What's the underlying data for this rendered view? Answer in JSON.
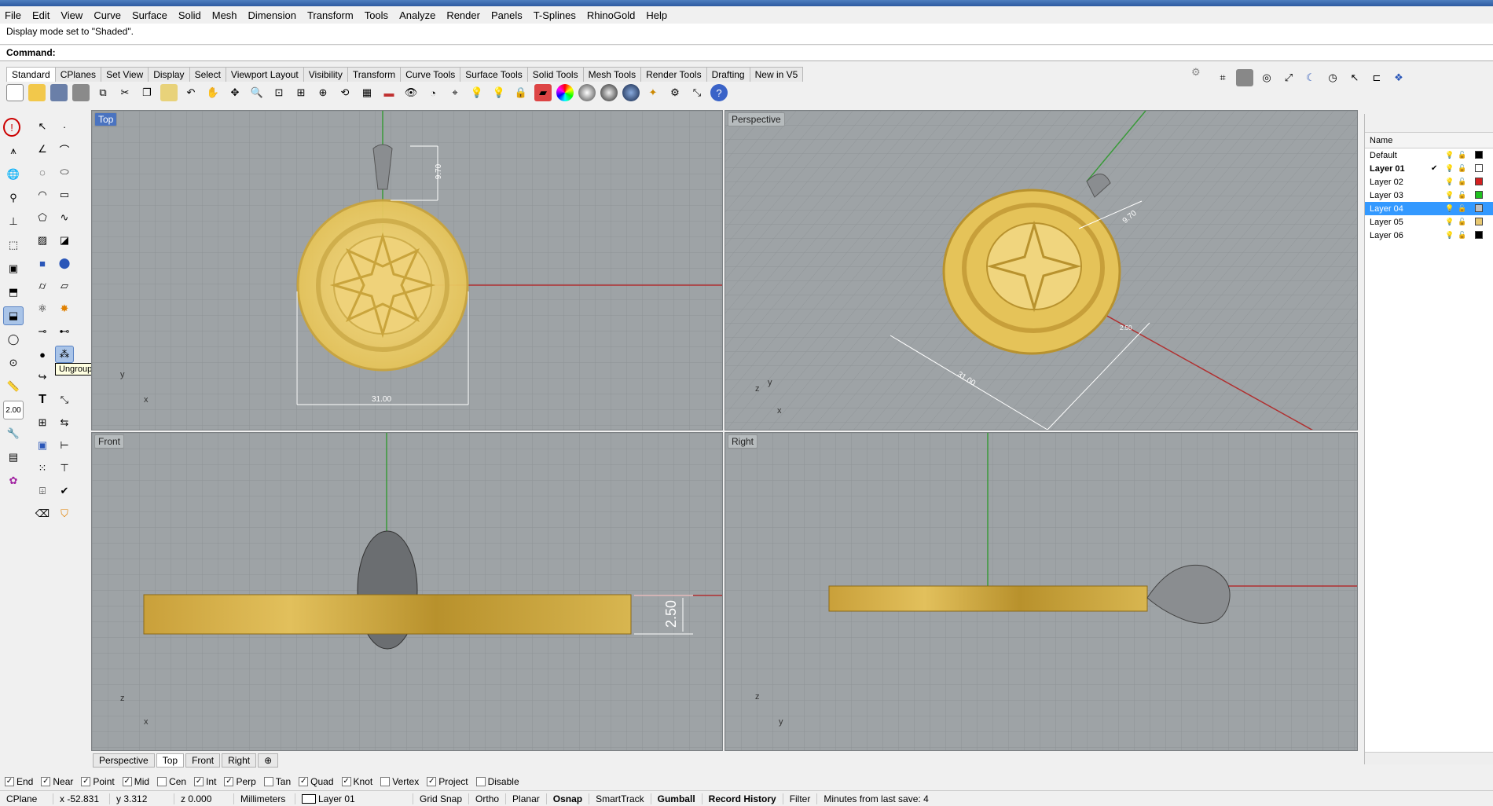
{
  "menu": [
    "File",
    "Edit",
    "View",
    "Curve",
    "Surface",
    "Solid",
    "Mesh",
    "Dimension",
    "Transform",
    "Tools",
    "Analyze",
    "Render",
    "Panels",
    "T-Splines",
    "RhinoGold",
    "Help"
  ],
  "command": {
    "history": "Display mode set to \"Shaded\".",
    "prompt": "Command:"
  },
  "toolbar_tabs": [
    "Standard",
    "CPlanes",
    "Set View",
    "Display",
    "Select",
    "Viewport Layout",
    "Visibility",
    "Transform",
    "Curve Tools",
    "Surface Tools",
    "Solid Tools",
    "Mesh Tools",
    "Render Tools",
    "Drafting",
    "New in V5"
  ],
  "tooltip": "Ungroup",
  "left_value": "2.00",
  "viewports": {
    "top": "Top",
    "perspective": "Perspective",
    "front": "Front",
    "right": "Right"
  },
  "dimensions": {
    "top_height": "9.70",
    "top_width": "31.00",
    "persp_height": "9.70",
    "persp_width": "31.00",
    "persp_small": "2.50",
    "front_thickness": "2.50"
  },
  "axes": {
    "x": "x",
    "y": "y",
    "z": "z"
  },
  "viewport_tabs": [
    "Perspective",
    "Top",
    "Front",
    "Right"
  ],
  "osnaps": [
    {
      "label": "End",
      "on": true
    },
    {
      "label": "Near",
      "on": true
    },
    {
      "label": "Point",
      "on": true
    },
    {
      "label": "Mid",
      "on": true
    },
    {
      "label": "Cen",
      "on": false
    },
    {
      "label": "Int",
      "on": true
    },
    {
      "label": "Perp",
      "on": true
    },
    {
      "label": "Tan",
      "on": false
    },
    {
      "label": "Quad",
      "on": true
    },
    {
      "label": "Knot",
      "on": true
    },
    {
      "label": "Vertex",
      "on": false
    },
    {
      "label": "Project",
      "on": true
    },
    {
      "label": "Disable",
      "on": false
    }
  ],
  "status": {
    "cplane": "CPlane",
    "x": "x -52.831",
    "y": "y 3.312",
    "z": "z 0.000",
    "units": "Millimeters",
    "layer": "Layer 01",
    "grid_snap": "Grid Snap",
    "ortho": "Ortho",
    "planar": "Planar",
    "osnap": "Osnap",
    "smarttrack": "SmartTrack",
    "gumball": "Gumball",
    "record_history": "Record History",
    "filter": "Filter",
    "save_info": "Minutes from last save: 4"
  },
  "layers": {
    "header": "Name",
    "rows": [
      {
        "name": "Default",
        "color": "#000000"
      },
      {
        "name": "Layer 01",
        "color": "#ffffff",
        "current": true
      },
      {
        "name": "Layer 02",
        "color": "#d42020"
      },
      {
        "name": "Layer 03",
        "color": "#20c020"
      },
      {
        "name": "Layer 04",
        "color": "#c0c0c0",
        "selected": true
      },
      {
        "name": "Layer 05",
        "color": "#e8c870"
      },
      {
        "name": "Layer 06",
        "color": "#000000"
      }
    ]
  },
  "icons": [
    "new-file-icon",
    "open-icon",
    "save-icon",
    "print-icon",
    "copy-icon",
    "cut-icon",
    "paste-icon",
    "undo-icon",
    "pan-icon",
    "zoom-icon",
    "settings-icon",
    "help-icon"
  ]
}
